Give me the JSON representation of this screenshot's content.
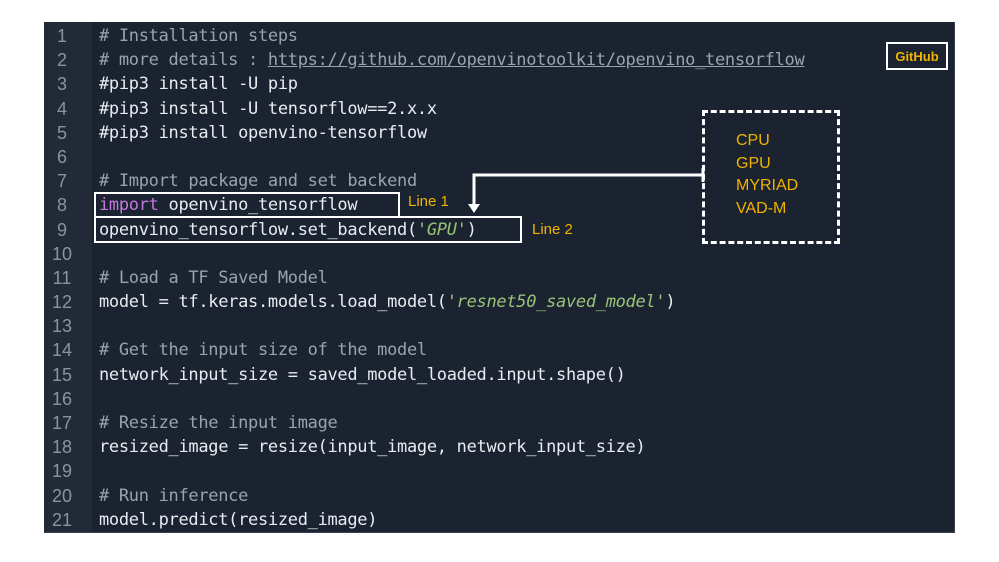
{
  "editor": {
    "lines": [
      {
        "num": "1",
        "parts": [
          {
            "t": "# Installation steps",
            "c": "comment"
          }
        ]
      },
      {
        "num": "2",
        "parts": [
          {
            "t": "# more details : ",
            "c": "comment"
          },
          {
            "t": "https://github.com/openvinotoolkit/openvino_tensorflow",
            "c": "link"
          }
        ]
      },
      {
        "num": "3",
        "parts": [
          {
            "t": "#pip3 install -U pip",
            "c": "plain"
          }
        ]
      },
      {
        "num": "4",
        "parts": [
          {
            "t": "#pip3 install -U tensorflow==2.x.x",
            "c": "plain"
          }
        ]
      },
      {
        "num": "5",
        "parts": [
          {
            "t": "#pip3 install openvino-tensorflow",
            "c": "plain"
          }
        ]
      },
      {
        "num": "6",
        "parts": []
      },
      {
        "num": "7",
        "parts": [
          {
            "t": "# Import package and set backend",
            "c": "comment"
          }
        ]
      },
      {
        "num": "8",
        "parts": [
          {
            "t": "import",
            "c": "kw"
          },
          {
            "t": " openvino_tensorflow",
            "c": "plain"
          }
        ]
      },
      {
        "num": "9",
        "parts": [
          {
            "t": "openvino_tensorflow.set_backend(",
            "c": "plain"
          },
          {
            "t": "'GPU'",
            "c": "str"
          },
          {
            "t": ")",
            "c": "plain"
          }
        ]
      },
      {
        "num": "10",
        "parts": []
      },
      {
        "num": "11",
        "parts": [
          {
            "t": "# Load a TF Saved Model",
            "c": "comment"
          }
        ]
      },
      {
        "num": "12",
        "parts": [
          {
            "t": "model = tf.keras.models.load_model(",
            "c": "plain"
          },
          {
            "t": "'resnet50_saved_model'",
            "c": "str"
          },
          {
            "t": ")",
            "c": "plain"
          }
        ]
      },
      {
        "num": "13",
        "parts": []
      },
      {
        "num": "14",
        "parts": [
          {
            "t": "# Get the input size of the model",
            "c": "comment"
          }
        ]
      },
      {
        "num": "15",
        "parts": [
          {
            "t": "network_input_size = saved_model_loaded.input.shape()",
            "c": "plain"
          }
        ]
      },
      {
        "num": "16",
        "parts": []
      },
      {
        "num": "17",
        "parts": [
          {
            "t": "# Resize the input image",
            "c": "comment"
          }
        ]
      },
      {
        "num": "18",
        "parts": [
          {
            "t": "resized_image = resize(input_image, network_input_size)",
            "c": "plain"
          }
        ]
      },
      {
        "num": "19",
        "parts": []
      },
      {
        "num": "20",
        "parts": [
          {
            "t": "# Run inference",
            "c": "comment"
          }
        ]
      },
      {
        "num": "21",
        "parts": [
          {
            "t": "model.predict(resized_image)",
            "c": "plain"
          }
        ]
      }
    ]
  },
  "annotations": {
    "github_button": "GitHub",
    "line1_label": "Line 1",
    "line2_label": "Line 2",
    "backends": [
      "CPU",
      "GPU",
      "MYRIAD",
      "VAD-M"
    ]
  },
  "colors": {
    "background": "#1b2330",
    "gutter": "#222a37",
    "keyword": "#c678dd",
    "string": "#98c379",
    "comment": "#9aa3ad",
    "annotation": "#f0b400"
  }
}
